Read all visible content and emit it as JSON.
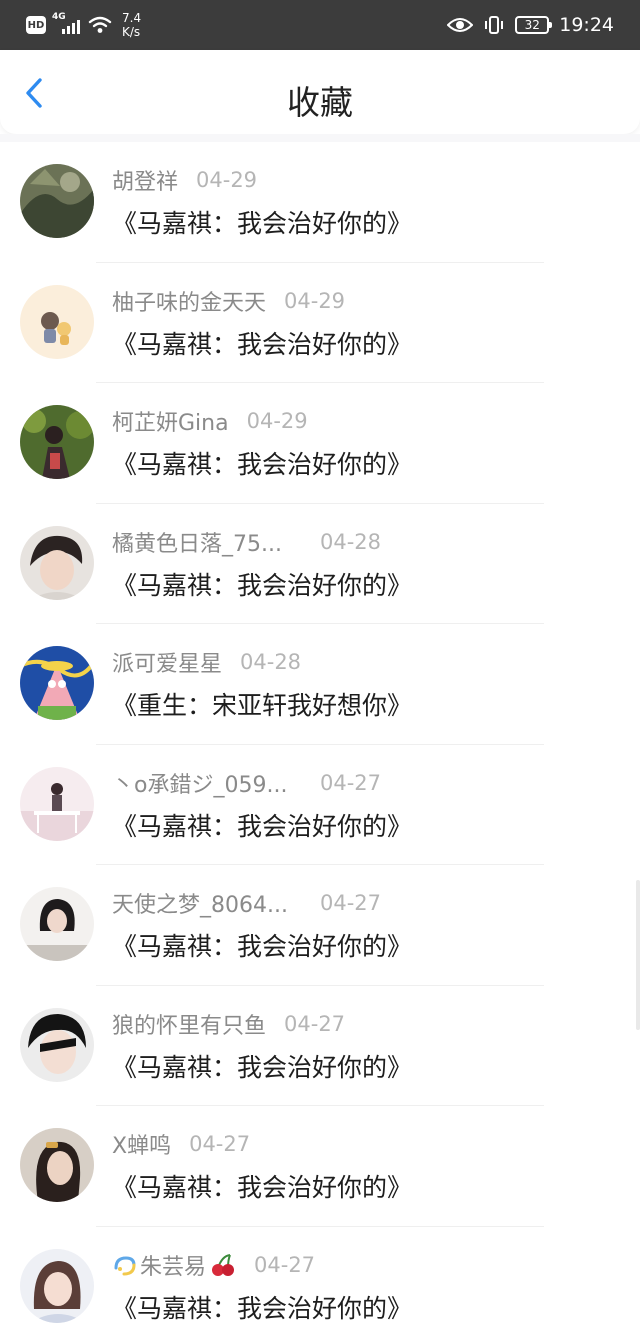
{
  "status_bar": {
    "hd": "HD",
    "network": "4G",
    "speed_value": "7.4",
    "speed_unit": "K/s",
    "battery": "32",
    "time": "19:24"
  },
  "header": {
    "title": "收藏"
  },
  "items": [
    {
      "name": "胡登祥",
      "date": "04-29",
      "work": "《马嘉祺：我会治好你的》"
    },
    {
      "name": "柚子味的金天天",
      "date": "04-29",
      "work": "《马嘉祺：我会治好你的》"
    },
    {
      "name": "柯芷妍Gina",
      "date": "04-29",
      "work": "《马嘉祺：我会治好你的》"
    },
    {
      "name": "橘黄色日落_75...",
      "date": "04-28",
      "work": "《马嘉祺：我会治好你的》"
    },
    {
      "name": "派可爱星星",
      "date": "04-28",
      "work": "《重生：宋亚轩我好想你》"
    },
    {
      "name": "丶o承錯ジ_059...",
      "date": "04-27",
      "work": "《马嘉祺：我会治好你的》"
    },
    {
      "name": "天使之梦_8064...",
      "date": "04-27",
      "work": "《马嘉祺：我会治好你的》"
    },
    {
      "name": "狼的怀里有只鱼",
      "date": "04-27",
      "work": "《马嘉祺：我会治好你的》"
    },
    {
      "name": "X蝉鸣",
      "date": "04-27",
      "work": "《马嘉祺：我会治好你的》"
    },
    {
      "name": "朱芸易",
      "date": "04-27",
      "work": "《马嘉祺：我会治好你的》"
    }
  ],
  "colors": {
    "accent": "#2e8bf0",
    "status_bar": "#3c3c3c",
    "name": "#8a8a8a",
    "date": "#b5b5b5"
  }
}
